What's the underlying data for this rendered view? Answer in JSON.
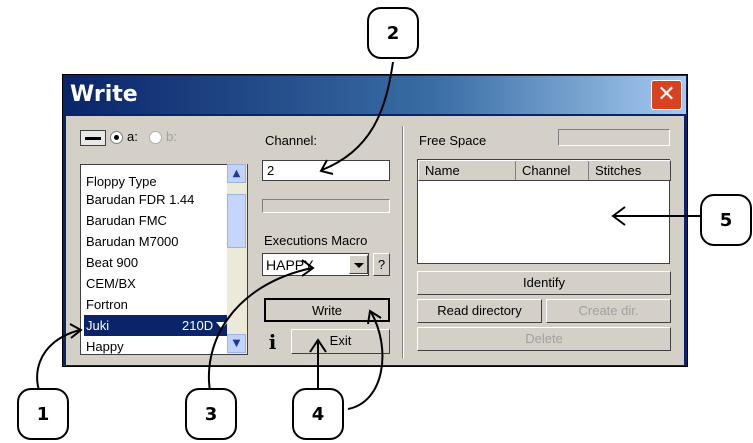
{
  "window": {
    "title": "Write",
    "close_symbol": "✕"
  },
  "drive": {
    "option_a": "a:",
    "option_b": "b:"
  },
  "floppy_list": {
    "header": "Floppy Type",
    "items": [
      "Barudan FDR 1.44",
      "Barudan FMC",
      "Barudan M7000",
      "Beat 900",
      "CEM/BX",
      "Fortron",
      "Juki",
      "Happy"
    ],
    "selected_index": 6,
    "selected_badge": "210D"
  },
  "channel": {
    "label": "Channel:",
    "value": "2"
  },
  "macro": {
    "label": "Executions Macro",
    "value": "HAPPY",
    "help": "?"
  },
  "buttons": {
    "write": "Write",
    "exit": "Exit",
    "info": "i"
  },
  "right_panel": {
    "free_space_label": "Free Space",
    "columns": [
      "Name",
      "Channel",
      "Stitches"
    ],
    "identify": "Identify",
    "read_directory": "Read directory",
    "create_dir": "Create dir.",
    "delete": "Delete"
  },
  "callouts": [
    "1",
    "2",
    "3",
    "4",
    "5"
  ],
  "colors": {
    "title_bar": "#0a246a",
    "selection": "#0a246a",
    "close_button": "#d9421f",
    "dialog_bg": "#d4d0c8"
  }
}
